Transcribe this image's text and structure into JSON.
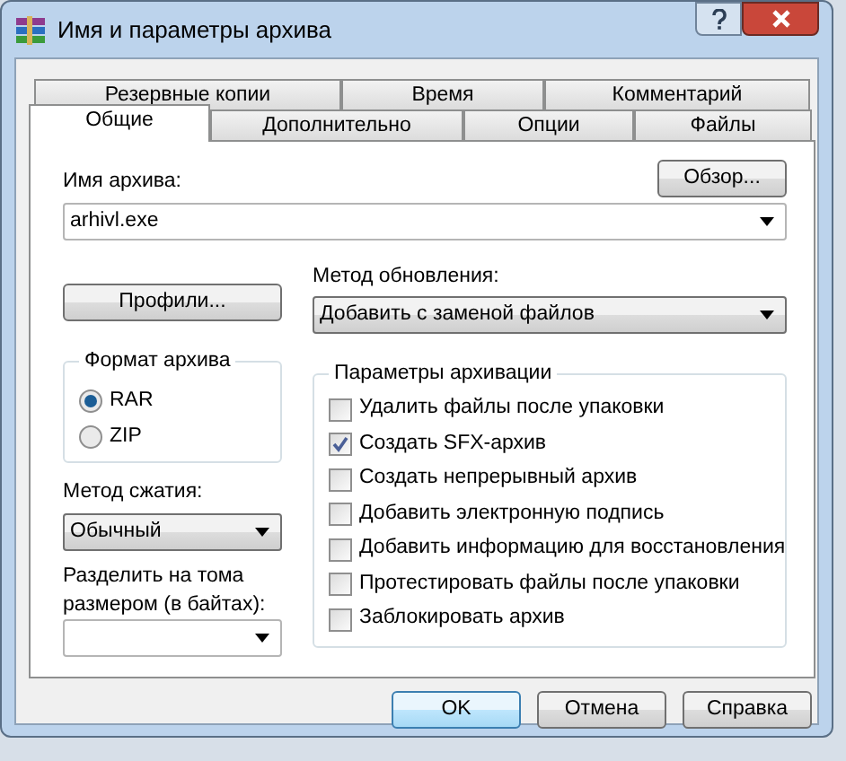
{
  "window": {
    "title": "Имя и параметры архива"
  },
  "tabs_back": [
    {
      "label": "Резервные копии",
      "selected": false
    },
    {
      "label": "Время",
      "selected": false
    },
    {
      "label": "Комментарий",
      "selected": false
    }
  ],
  "tabs_front": [
    {
      "label": "Общие",
      "selected": true
    },
    {
      "label": "Дополнительно",
      "selected": false
    },
    {
      "label": "Опции",
      "selected": false
    },
    {
      "label": "Файлы",
      "selected": false
    }
  ],
  "browse_button": "Обзор...",
  "archive_name": {
    "label": "Имя архива:",
    "value": "arhivl.exe"
  },
  "profiles_button": "Профили...",
  "update_method": {
    "label": "Метод обновления:",
    "value": "Добавить с заменой файлов"
  },
  "archive_format": {
    "title": "Формат архива",
    "options": [
      {
        "label": "RAR",
        "selected": true
      },
      {
        "label": "ZIP",
        "selected": false
      }
    ]
  },
  "compression_method": {
    "label": "Метод сжатия:",
    "value": "Обычный"
  },
  "split_volumes": {
    "label": "Разделить на тома размером (в байтах):"
  },
  "archiving_options": {
    "title": "Параметры архивации",
    "items": [
      {
        "label": "Удалить файлы после упаковки",
        "checked": false
      },
      {
        "label": "Создать SFX-архив",
        "checked": true
      },
      {
        "label": "Создать непрерывный архив",
        "checked": false
      },
      {
        "label": "Добавить электронную подпись",
        "checked": false
      },
      {
        "label": "Добавить информацию для восстановления",
        "checked": false
      },
      {
        "label": "Протестировать файлы после упаковки",
        "checked": false
      },
      {
        "label": "Заблокировать архив",
        "checked": false
      }
    ]
  },
  "buttons": [
    {
      "label": "OK",
      "default": true
    },
    {
      "label": "Отмена",
      "default": false
    },
    {
      "label": "Справка",
      "default": false
    }
  ]
}
